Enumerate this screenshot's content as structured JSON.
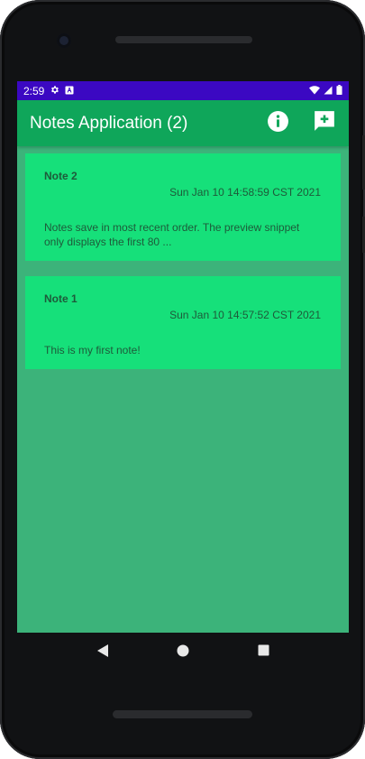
{
  "status_bar": {
    "time": "2:59",
    "color": "#3b08c2"
  },
  "app_bar": {
    "title": "Notes Application (2)",
    "color": "#0fa65a",
    "actions": [
      "info-icon",
      "add-note-icon"
    ]
  },
  "colors": {
    "background": "#3cb37a",
    "card": "#16e07a",
    "card_text": "#1e5a3a"
  },
  "notes": [
    {
      "title": "Note 2",
      "date": "Sun Jan 10 14:58:59 CST 2021",
      "snippet": "Notes save in most recent order. The preview snippet only displays the first 80 ..."
    },
    {
      "title": "Note 1",
      "date": "Sun Jan 10 14:57:52 CST 2021",
      "snippet": "This is my first note!"
    }
  ],
  "nav": [
    "back-icon",
    "home-icon",
    "recents-icon"
  ]
}
